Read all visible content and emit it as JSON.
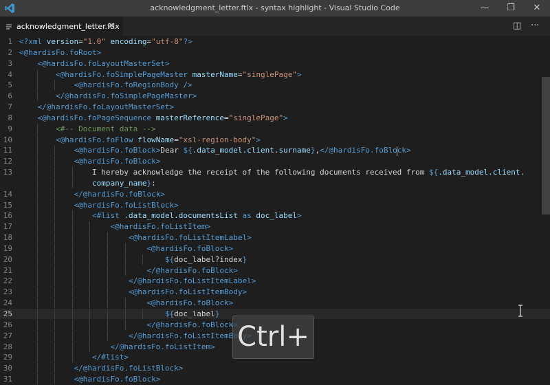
{
  "window": {
    "title": "acknowledgment_letter.ftlx - syntax highlight - Visual Studio Code",
    "minimize_glyph": "—",
    "restore_glyph": "❐",
    "close_glyph": "✕"
  },
  "tab": {
    "label": "acknowledgment_letter.ftlx",
    "close_glyph": "✕"
  },
  "editor_actions": {
    "split_glyph": "◫",
    "more_glyph": "···"
  },
  "overlay": {
    "text": "Ctrl+"
  },
  "colors": {
    "tag": "#569cd6",
    "attribute": "#9cdcfe",
    "string": "#ce9178",
    "comment": "#6a9955",
    "text": "#d4d4d4",
    "logo": "#3c99d4",
    "titlebar": "#3c3c3c"
  },
  "icons": [
    "vscode-logo-icon",
    "file-icon",
    "close-icon",
    "split-editor-icon",
    "more-actions-icon",
    "text-cursor-icon"
  ],
  "lines": [
    {
      "num": "1",
      "tokens": [
        [
          "tg",
          "<?xml "
        ],
        [
          "an",
          "version"
        ],
        [
          "",
          "="
        ],
        [
          "av",
          "\"1.0\""
        ],
        [
          "an",
          " encoding"
        ],
        [
          "",
          "="
        ],
        [
          "av",
          "\"utf-8\""
        ],
        [
          "tg",
          "?>"
        ]
      ]
    },
    {
      "num": "2",
      "tokens": [
        [
          "tg",
          "<@hardisFo.foRoot>"
        ]
      ]
    },
    {
      "num": "3",
      "tokens": [
        [
          "",
          "    "
        ],
        [
          "tg",
          "<@hardisFo.foLayoutMasterSet>"
        ]
      ]
    },
    {
      "num": "4",
      "tokens": [
        [
          "",
          "        "
        ],
        [
          "tg",
          "<@hardisFo.foSimplePageMaster "
        ],
        [
          "an",
          "masterName"
        ],
        [
          "",
          "="
        ],
        [
          "av",
          "\"singlePage\""
        ],
        [
          "tg",
          ">"
        ]
      ]
    },
    {
      "num": "5",
      "tokens": [
        [
          "",
          "            "
        ],
        [
          "tg",
          "<@hardisFo.foRegionBody />"
        ]
      ]
    },
    {
      "num": "6",
      "tokens": [
        [
          "",
          "        "
        ],
        [
          "tg",
          "</@hardisFo.foSimplePageMaster>"
        ]
      ]
    },
    {
      "num": "7",
      "tokens": [
        [
          "",
          "    "
        ],
        [
          "tg",
          "</@hardisFo.foLayoutMasterSet>"
        ]
      ]
    },
    {
      "num": "8",
      "tokens": [
        [
          "",
          "    "
        ],
        [
          "tg",
          "<@hardisFo.foPageSequence "
        ],
        [
          "an",
          "masterReference"
        ],
        [
          "",
          "="
        ],
        [
          "av",
          "\"singlePage\""
        ],
        [
          "tg",
          ">"
        ]
      ]
    },
    {
      "num": "9",
      "tokens": [
        [
          "",
          "        "
        ],
        [
          "cm",
          "<#-- Document data -->"
        ]
      ]
    },
    {
      "num": "10",
      "tokens": [
        [
          "",
          "        "
        ],
        [
          "tg",
          "<@hardisFo.foFlow "
        ],
        [
          "an",
          "flowName"
        ],
        [
          "",
          "="
        ],
        [
          "av",
          "\"xsl-region-body\""
        ],
        [
          "tg",
          ">"
        ]
      ]
    },
    {
      "num": "11",
      "tokens": [
        [
          "",
          "            "
        ],
        [
          "tg",
          "<@hardisFo.foBlock>"
        ],
        [
          "",
          "Dear "
        ],
        [
          "tg",
          "${"
        ],
        [
          "an",
          ".data_model.client.surname"
        ],
        [
          "tg",
          "}"
        ],
        [
          "",
          ","
        ],
        [
          "tg",
          "</@hardisFo.foBlock>"
        ]
      ]
    },
    {
      "num": "12",
      "tokens": [
        [
          "",
          "            "
        ],
        [
          "tg",
          "<@hardisFo.foBlock>"
        ]
      ]
    },
    {
      "num": "13",
      "tokens": [
        [
          "",
          "                I hereby acknowledge the receipt of the following documents received from "
        ],
        [
          "tg",
          "${"
        ],
        [
          "an",
          ".data_model.client."
        ]
      ]
    },
    {
      "num": "",
      "tokens": [
        [
          "",
          "                "
        ],
        [
          "an",
          "company_name"
        ],
        [
          "tg",
          "}"
        ],
        [
          "",
          ":"
        ]
      ]
    },
    {
      "num": "14",
      "tokens": [
        [
          "",
          "            "
        ],
        [
          "tg",
          "</@hardisFo.foBlock>"
        ]
      ]
    },
    {
      "num": "15",
      "tokens": [
        [
          "",
          "            "
        ],
        [
          "tg",
          "<@hardisFo.foListBlock>"
        ]
      ]
    },
    {
      "num": "16",
      "tokens": [
        [
          "",
          "                "
        ],
        [
          "tg",
          "<#list "
        ],
        [
          "an",
          ".data_model.documentsList"
        ],
        [
          "tg",
          " as "
        ],
        [
          "an",
          "doc_label"
        ],
        [
          "tg",
          ">"
        ]
      ]
    },
    {
      "num": "17",
      "tokens": [
        [
          "",
          "                    "
        ],
        [
          "tg",
          "<@hardisFo.foListItem>"
        ]
      ]
    },
    {
      "num": "18",
      "tokens": [
        [
          "",
          "                        "
        ],
        [
          "tg",
          "<@hardisFo.foListItemLabel>"
        ]
      ]
    },
    {
      "num": "19",
      "tokens": [
        [
          "",
          "                            "
        ],
        [
          "tg",
          "<@hardisFo.foBlock>"
        ]
      ]
    },
    {
      "num": "20",
      "tokens": [
        [
          "",
          "                                "
        ],
        [
          "tg",
          "${"
        ],
        [
          "",
          "doc_label?index"
        ],
        [
          "tg",
          "}"
        ]
      ]
    },
    {
      "num": "21",
      "tokens": [
        [
          "",
          "                            "
        ],
        [
          "tg",
          "</@hardisFo.foBlock>"
        ]
      ]
    },
    {
      "num": "22",
      "tokens": [
        [
          "",
          "                        "
        ],
        [
          "tg",
          "</@hardisFo.foListItemLabel>"
        ]
      ]
    },
    {
      "num": "23",
      "tokens": [
        [
          "",
          "                        "
        ],
        [
          "tg",
          "<@hardisFo.foListItemBody>"
        ]
      ]
    },
    {
      "num": "24",
      "tokens": [
        [
          "",
          "                            "
        ],
        [
          "tg",
          "<@hardisFo.foBlock>"
        ]
      ]
    },
    {
      "num": "25",
      "tokens": [
        [
          "",
          "                                "
        ],
        [
          "tg",
          "${"
        ],
        [
          "",
          "doc_label"
        ],
        [
          "tg",
          "}"
        ]
      ]
    },
    {
      "num": "26",
      "tokens": [
        [
          "",
          "                            "
        ],
        [
          "tg",
          "</@hardisFo.foBlock>"
        ]
      ]
    },
    {
      "num": "27",
      "tokens": [
        [
          "",
          "                        "
        ],
        [
          "tg",
          "</@hardisFo.foListItemBody>"
        ]
      ]
    },
    {
      "num": "28",
      "tokens": [
        [
          "",
          "                    "
        ],
        [
          "tg",
          "</@hardisFo.foListItem>"
        ]
      ]
    },
    {
      "num": "29",
      "tokens": [
        [
          "",
          "                "
        ],
        [
          "tg",
          "</#list>"
        ]
      ]
    },
    {
      "num": "30",
      "tokens": [
        [
          "",
          "            "
        ],
        [
          "tg",
          "</@hardisFo.foListBlock>"
        ]
      ]
    },
    {
      "num": "31",
      "tokens": [
        [
          "",
          "            "
        ],
        [
          "tg",
          "<@hardisFo.foBlock>"
        ]
      ]
    }
  ]
}
